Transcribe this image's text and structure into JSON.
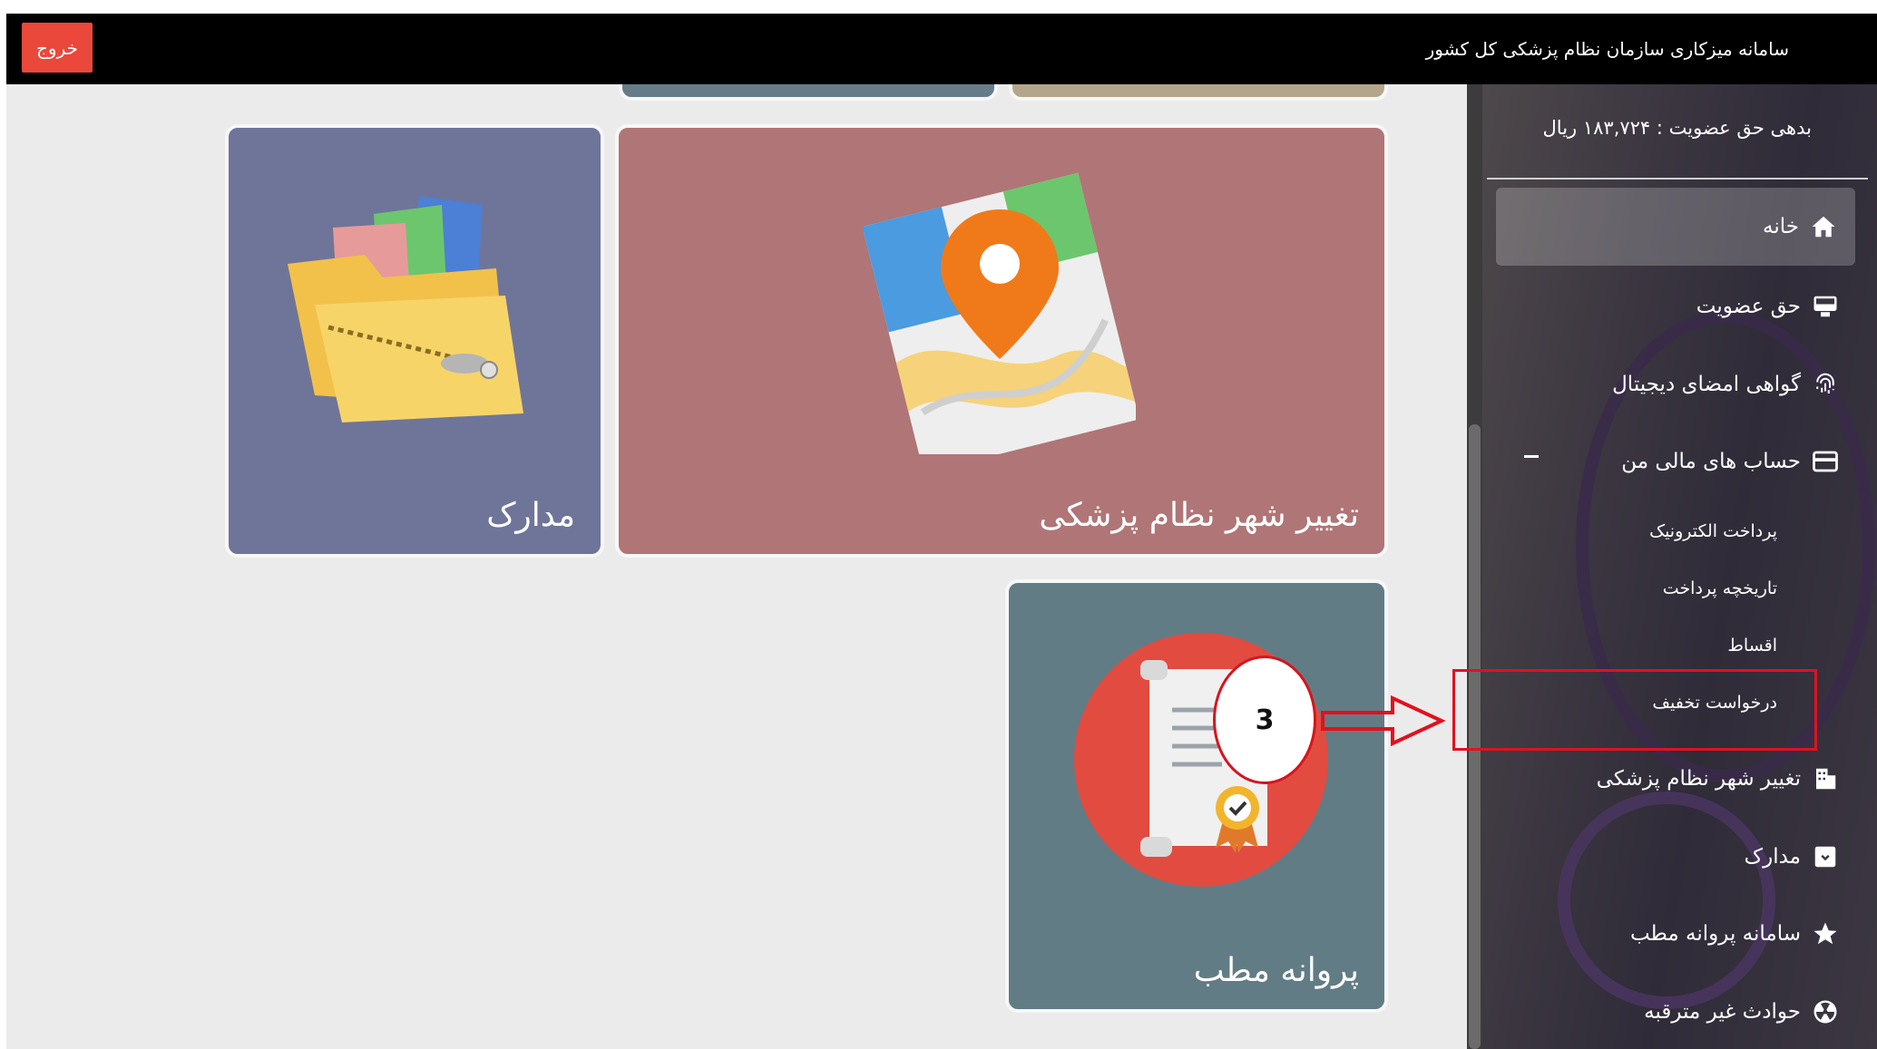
{
  "header": {
    "app_title": "سامانه میزکاری سازمان نظام پزشکی کل کشور",
    "logout_label": "خروج"
  },
  "tiles": {
    "docs": {
      "label": "مدارک",
      "color": "#6f7599"
    },
    "change_city": {
      "label": "تغییر شهر نظام پزشکی",
      "color": "#b07577"
    },
    "license": {
      "label": "پروانه مطب",
      "color": "#627c85"
    }
  },
  "sidebar": {
    "debt_text": "بدهی حق عضویت : ۱۸۳,۷۲۴ ریال",
    "items": [
      {
        "label": "خانه",
        "icon": "home-icon"
      },
      {
        "label": "حق عضویت",
        "icon": "monitor-icon"
      },
      {
        "label": "گواهی امضای دیجیتال",
        "icon": "fingerprint-icon"
      },
      {
        "label": "حساب های مالی من",
        "icon": "card-icon"
      },
      {
        "label": "تغییر شهر نظام پزشکی",
        "icon": "building-icon"
      },
      {
        "label": "مدارک",
        "icon": "archive-icon"
      },
      {
        "label": "سامانه پروانه مطب",
        "icon": "star-icon"
      },
      {
        "label": "حوادث غیر مترقبه",
        "icon": "radiation-icon"
      }
    ],
    "sub_items": [
      {
        "label": "پرداخت الکترونیک"
      },
      {
        "label": "تاریخچه پرداخت"
      },
      {
        "label": "اقساط"
      },
      {
        "label": "درخواست تخفیف"
      }
    ]
  },
  "annotation": {
    "step_number": "3",
    "highlight_color": "#e3101e"
  }
}
